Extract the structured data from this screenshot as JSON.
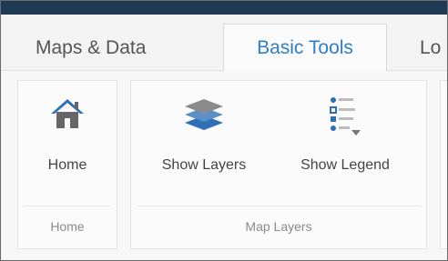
{
  "tabs": [
    {
      "label": "Maps & Data"
    },
    {
      "label": "Basic Tools",
      "active": true
    },
    {
      "label": "Lo"
    }
  ],
  "ribbon": {
    "groups": [
      {
        "label": "Home",
        "tools": [
          {
            "label": "Home",
            "icon": "home-icon"
          }
        ]
      },
      {
        "label": "Map Layers",
        "tools": [
          {
            "label": "Show Layers",
            "icon": "layers-icon"
          },
          {
            "label": "Show Legend",
            "icon": "legend-icon"
          }
        ]
      }
    ]
  },
  "colors": {
    "top_bar": "#1f3a55",
    "active_tab_text": "#2f7ec4",
    "icon_blue": "#2f6fb5",
    "icon_gray": "#666666"
  }
}
